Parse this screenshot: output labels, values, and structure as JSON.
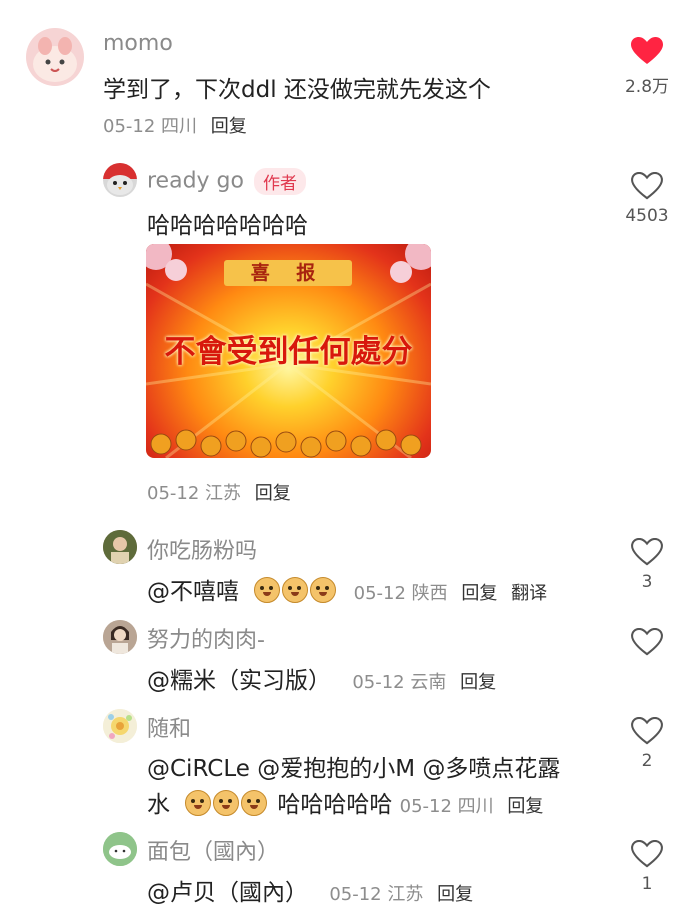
{
  "comments": [
    {
      "user": "momo",
      "text": "学到了，下次ddl 还没做完就先发这个",
      "date": "05-12",
      "location": "四川",
      "reply": "回复",
      "likes": "2.8万",
      "liked": true
    },
    {
      "user": "ready go",
      "author_tag": "作者",
      "text": "哈哈哈哈哈哈哈",
      "image": {
        "banner": "喜 报",
        "headline": "不會受到任何處分"
      },
      "date": "05-12",
      "location": "江苏",
      "reply": "回复",
      "likes": "4503"
    },
    {
      "user": "你吃肠粉吗",
      "mention": "@不嘻嘻",
      "date": "05-12",
      "location": "陕西",
      "reply": "回复",
      "translate": "翻译",
      "likes": "3"
    },
    {
      "user": "努力的肉肉-",
      "mention": "@糯米（实习版）",
      "date": "05-12",
      "location": "云南",
      "reply": "回复"
    },
    {
      "user": "随和",
      "line1": "@CiRCLe  @爱抱抱的小M  @多喷点花露",
      "line2_start": "水",
      "line2_end": "哈哈哈哈哈",
      "date": "05-12",
      "location": "四川",
      "reply": "回复",
      "likes": "2"
    },
    {
      "user": "面包（國內）",
      "mention": "@卢贝（國內）",
      "date": "05-12",
      "location": "江苏",
      "reply": "回复",
      "likes": "1"
    }
  ],
  "colors": {
    "accent": "#ff2442",
    "meta": "#8d8d8d"
  },
  "icons": {
    "like": "heart-icon",
    "like_filled": "heart-filled-icon",
    "emoji": "smiling-face-emoji-icon"
  }
}
